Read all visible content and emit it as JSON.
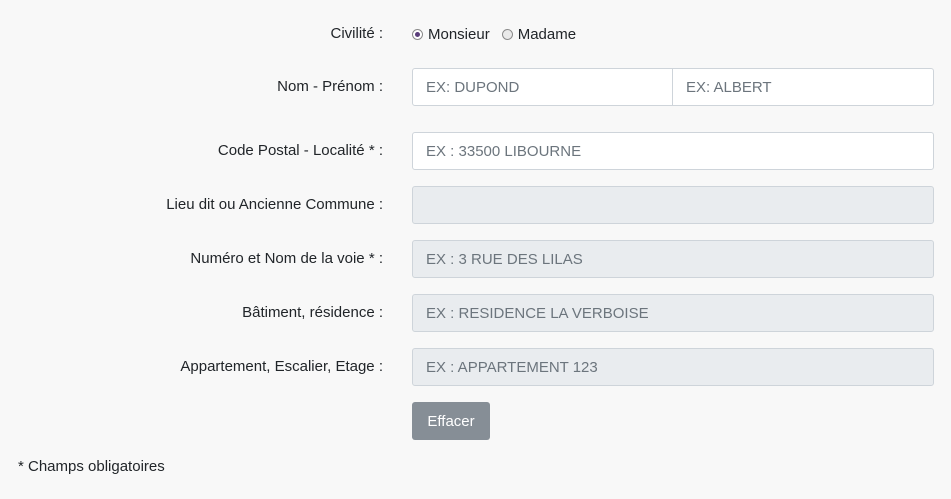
{
  "civilite": {
    "label": "Civilité :",
    "options": [
      {
        "label": "Monsieur",
        "checked": true
      },
      {
        "label": "Madame",
        "checked": false
      }
    ]
  },
  "nom_prenom": {
    "label": "Nom - Prénom :",
    "nom_placeholder": "EX: DUPOND",
    "prenom_placeholder": "EX: ALBERT"
  },
  "code_postal": {
    "label": "Code Postal - Localité * :",
    "placeholder": "EX : 33500 LIBOURNE"
  },
  "lieu_dit": {
    "label": "Lieu dit ou Ancienne Commune :",
    "placeholder": ""
  },
  "voie": {
    "label": "Numéro et Nom de la voie * :",
    "placeholder": "EX : 3 RUE DES LILAS"
  },
  "batiment": {
    "label": "Bâtiment, résidence :",
    "placeholder": "EX : RESIDENCE LA VERBOISE"
  },
  "appartement": {
    "label": "Appartement, Escalier, Etage :",
    "placeholder": "EX : APPARTEMENT 123"
  },
  "actions": {
    "clear_label": "Effacer"
  },
  "footer": {
    "note": "* Champs obligatoires"
  },
  "colors": {
    "background": "#f8f8f8",
    "disabled_field": "#e9ecef",
    "button": "#868e96",
    "radio_checked": "#5a3d7a"
  }
}
